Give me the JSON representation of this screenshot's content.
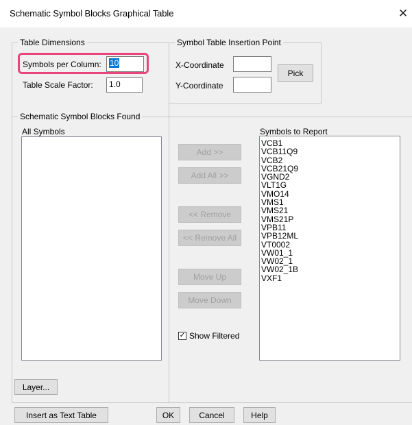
{
  "window": {
    "title": "Schematic Symbol Blocks Graphical Table",
    "close_glyph": "✕"
  },
  "dimensions": {
    "legend": "Table Dimensions",
    "symbols_per_column_label": "Symbols per Column:",
    "symbols_per_column_value": "10",
    "scale_label": "Table Scale Factor:",
    "scale_value": "1.0"
  },
  "insertion": {
    "legend": "Symbol Table Insertion Point",
    "x_label": "X-Coordinate",
    "x_value": "",
    "y_label": "Y-Coordinate",
    "y_value": "",
    "pick_label": "Pick"
  },
  "found": {
    "legend": "Schematic Symbol Blocks Found",
    "all_label": "All Symbols",
    "report_label": "Symbols to Report",
    "report_items": [
      "VCB1",
      "VCB11Q9",
      "VCB2",
      "VCB21Q9",
      "VGND2",
      "VLT1G",
      "VMO14",
      "VMS1",
      "VMS21",
      "VMS21P",
      "VPB11",
      "VPB12ML",
      "VT0002",
      "VW01_1",
      "VW02_1",
      "VW02_1B",
      "VXF1"
    ],
    "add_label": "Add >>",
    "add_all_label": "Add All >>",
    "remove_label": "<< Remove",
    "remove_all_label": "<< Remove All",
    "move_up_label": "Move Up",
    "move_down_label": "Move Down",
    "show_filtered_label": "Show Filtered",
    "show_filtered_checked": true
  },
  "footer": {
    "layer_label": "Layer...",
    "insert_text_label": "Insert as Text Table",
    "ok_label": "OK",
    "cancel_label": "Cancel",
    "help_label": "Help"
  },
  "colors": {
    "highlight": "#e8457f",
    "selection": "#0078d7"
  }
}
